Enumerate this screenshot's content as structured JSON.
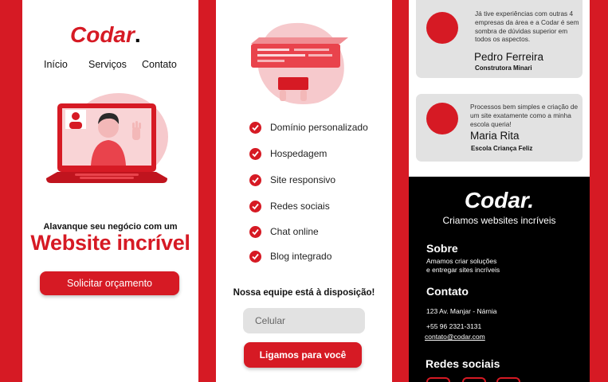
{
  "brand": {
    "name": "Codar",
    "dot": ".",
    "accent": "#d61a24"
  },
  "screen1": {
    "nav": [
      "Início",
      "Serviços",
      "Contato"
    ],
    "hero_small": "Alavanque seu negócio com um",
    "hero_big": "Website incrível",
    "cta": "Solicitar orçamento"
  },
  "screen2": {
    "features": [
      "Domínio personalizado",
      "Hospedagem",
      "Site responsivo",
      "Redes sociais",
      "Chat online",
      "Blog integrado"
    ],
    "team_title": "Nossa equipe está à disposição!",
    "phone_placeholder": "Celular",
    "cta": "Ligamos para você"
  },
  "screen3": {
    "testimonials": [
      {
        "quote": "Já tive experiências com outras 4 empresas da área e a Codar é sem sombra de dúvidas superior em todos os aspectos.",
        "name": "Pedro Ferreira",
        "company": "Construtora Minari"
      },
      {
        "quote": "Processos bem simples e criação de um site exatamente como a minha escola queria!",
        "name": "Maria Rita",
        "company": "Escola Criança Feliz"
      }
    ],
    "footer": {
      "logo": "Codar.",
      "tagline": "Criamos websites incríveis",
      "about_title": "Sobre",
      "about_line1": "Amamos criar soluções",
      "about_line2": "e entregar sites incríveis",
      "contact_title": "Contato",
      "address": "123 Av. Manjar - Nárnia",
      "phone": "+55 96 2321-3131",
      "email": "contato@codar.com",
      "social_title": "Redes sociais"
    }
  }
}
